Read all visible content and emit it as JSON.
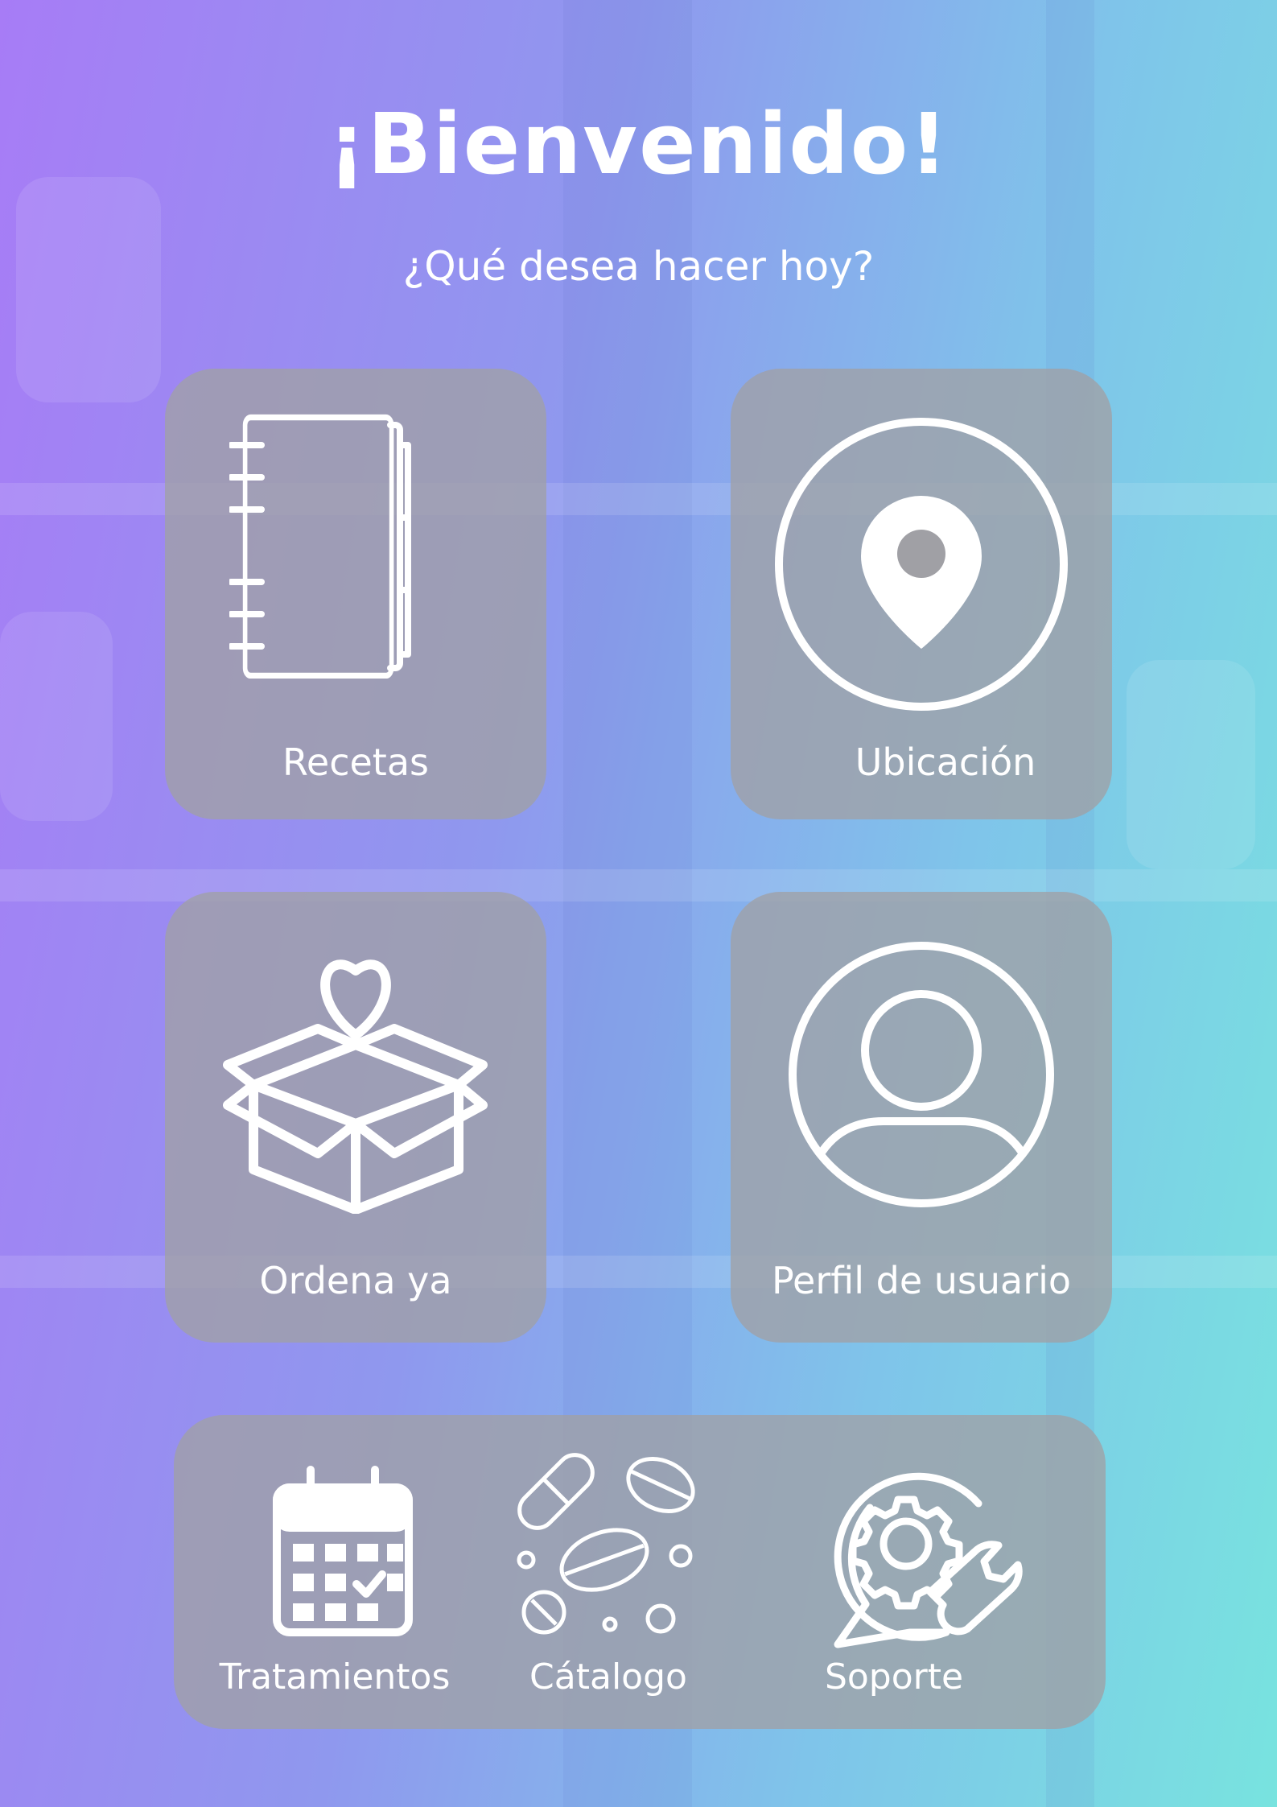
{
  "header": {
    "title": "¡Bienvenido!",
    "subtitle": "¿Qué desea hacer hoy?"
  },
  "menu": {
    "recetas": {
      "label": "Recetas",
      "icon": "notebook-icon"
    },
    "ubicacion": {
      "label": "Ubicación",
      "icon": "location-pin-icon"
    },
    "ordena": {
      "label": "Ordena ya",
      "icon": "gift-box-heart-icon"
    },
    "perfil": {
      "label": "Perfil de usuario",
      "icon": "user-profile-icon"
    }
  },
  "bottom": {
    "tratamientos": {
      "label": "Tratamientos",
      "icon": "calendar-icon"
    },
    "catalogo": {
      "label": "Cátalogo",
      "icon": "pills-icon"
    },
    "soporte": {
      "label": "Soporte",
      "icon": "support-gear-wrench-icon"
    }
  },
  "colors": {
    "gradient_left": "#a77cf6",
    "gradient_right": "#78e3df",
    "card": "#a0a0a5",
    "text": "#ffffff"
  }
}
